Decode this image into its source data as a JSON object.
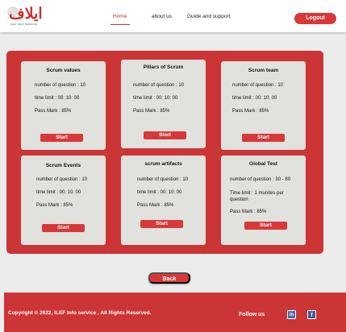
{
  "header": {
    "logo_text": "ايلاف",
    "logo_subtext": "ILEF INFO SERVICE",
    "nav": [
      {
        "label": "Home"
      },
      {
        "label": "about us"
      },
      {
        "label": "Guide and support"
      }
    ],
    "logout_label": "Logout"
  },
  "cards": [
    {
      "title": "Scrum values",
      "questions": "number of question : 10",
      "time": "time limit : 00: 10: 00",
      "pass": "Pass Mark : 85%",
      "button": "Start"
    },
    {
      "title": "Pillars of Scrum",
      "questions": "number of question : 10",
      "time": "time limit : 00: 10: 00",
      "pass": "Pass Mark : 85%",
      "button": "Start"
    },
    {
      "title": "Scrum team",
      "questions": "number of question : 10",
      "time": "time limit : 00: 10: 00",
      "pass": "Pass Mark : 85%",
      "button": "Start"
    },
    {
      "title": "Scrum Events",
      "questions": "number of question : 10",
      "time": "time limit : 00: 10: 00",
      "pass": "Pass Mark : 85%",
      "button": "Start"
    },
    {
      "title": "scrum artifacts",
      "questions": "number of question : 10",
      "time": "time limit : 00: 10: 00",
      "pass": "Pass Mark : 85%",
      "button": "Start"
    },
    {
      "title": "Global Test",
      "questions": "number of question : 30 - 80",
      "time": "Time limit : 1 munites per question",
      "pass": "Pass Mark : 85%",
      "button": "Start"
    }
  ],
  "back_label": "Back",
  "footer": {
    "copyright": "Copyright © 2022, ILEF Info service , All Rights Reserved.",
    "follow_label": "Follow us",
    "linkedin_glyph": "in",
    "facebook_glyph": "f"
  },
  "colors": {
    "accent": "#cc3535",
    "button": "#d93838",
    "card": "#e1e1de"
  }
}
